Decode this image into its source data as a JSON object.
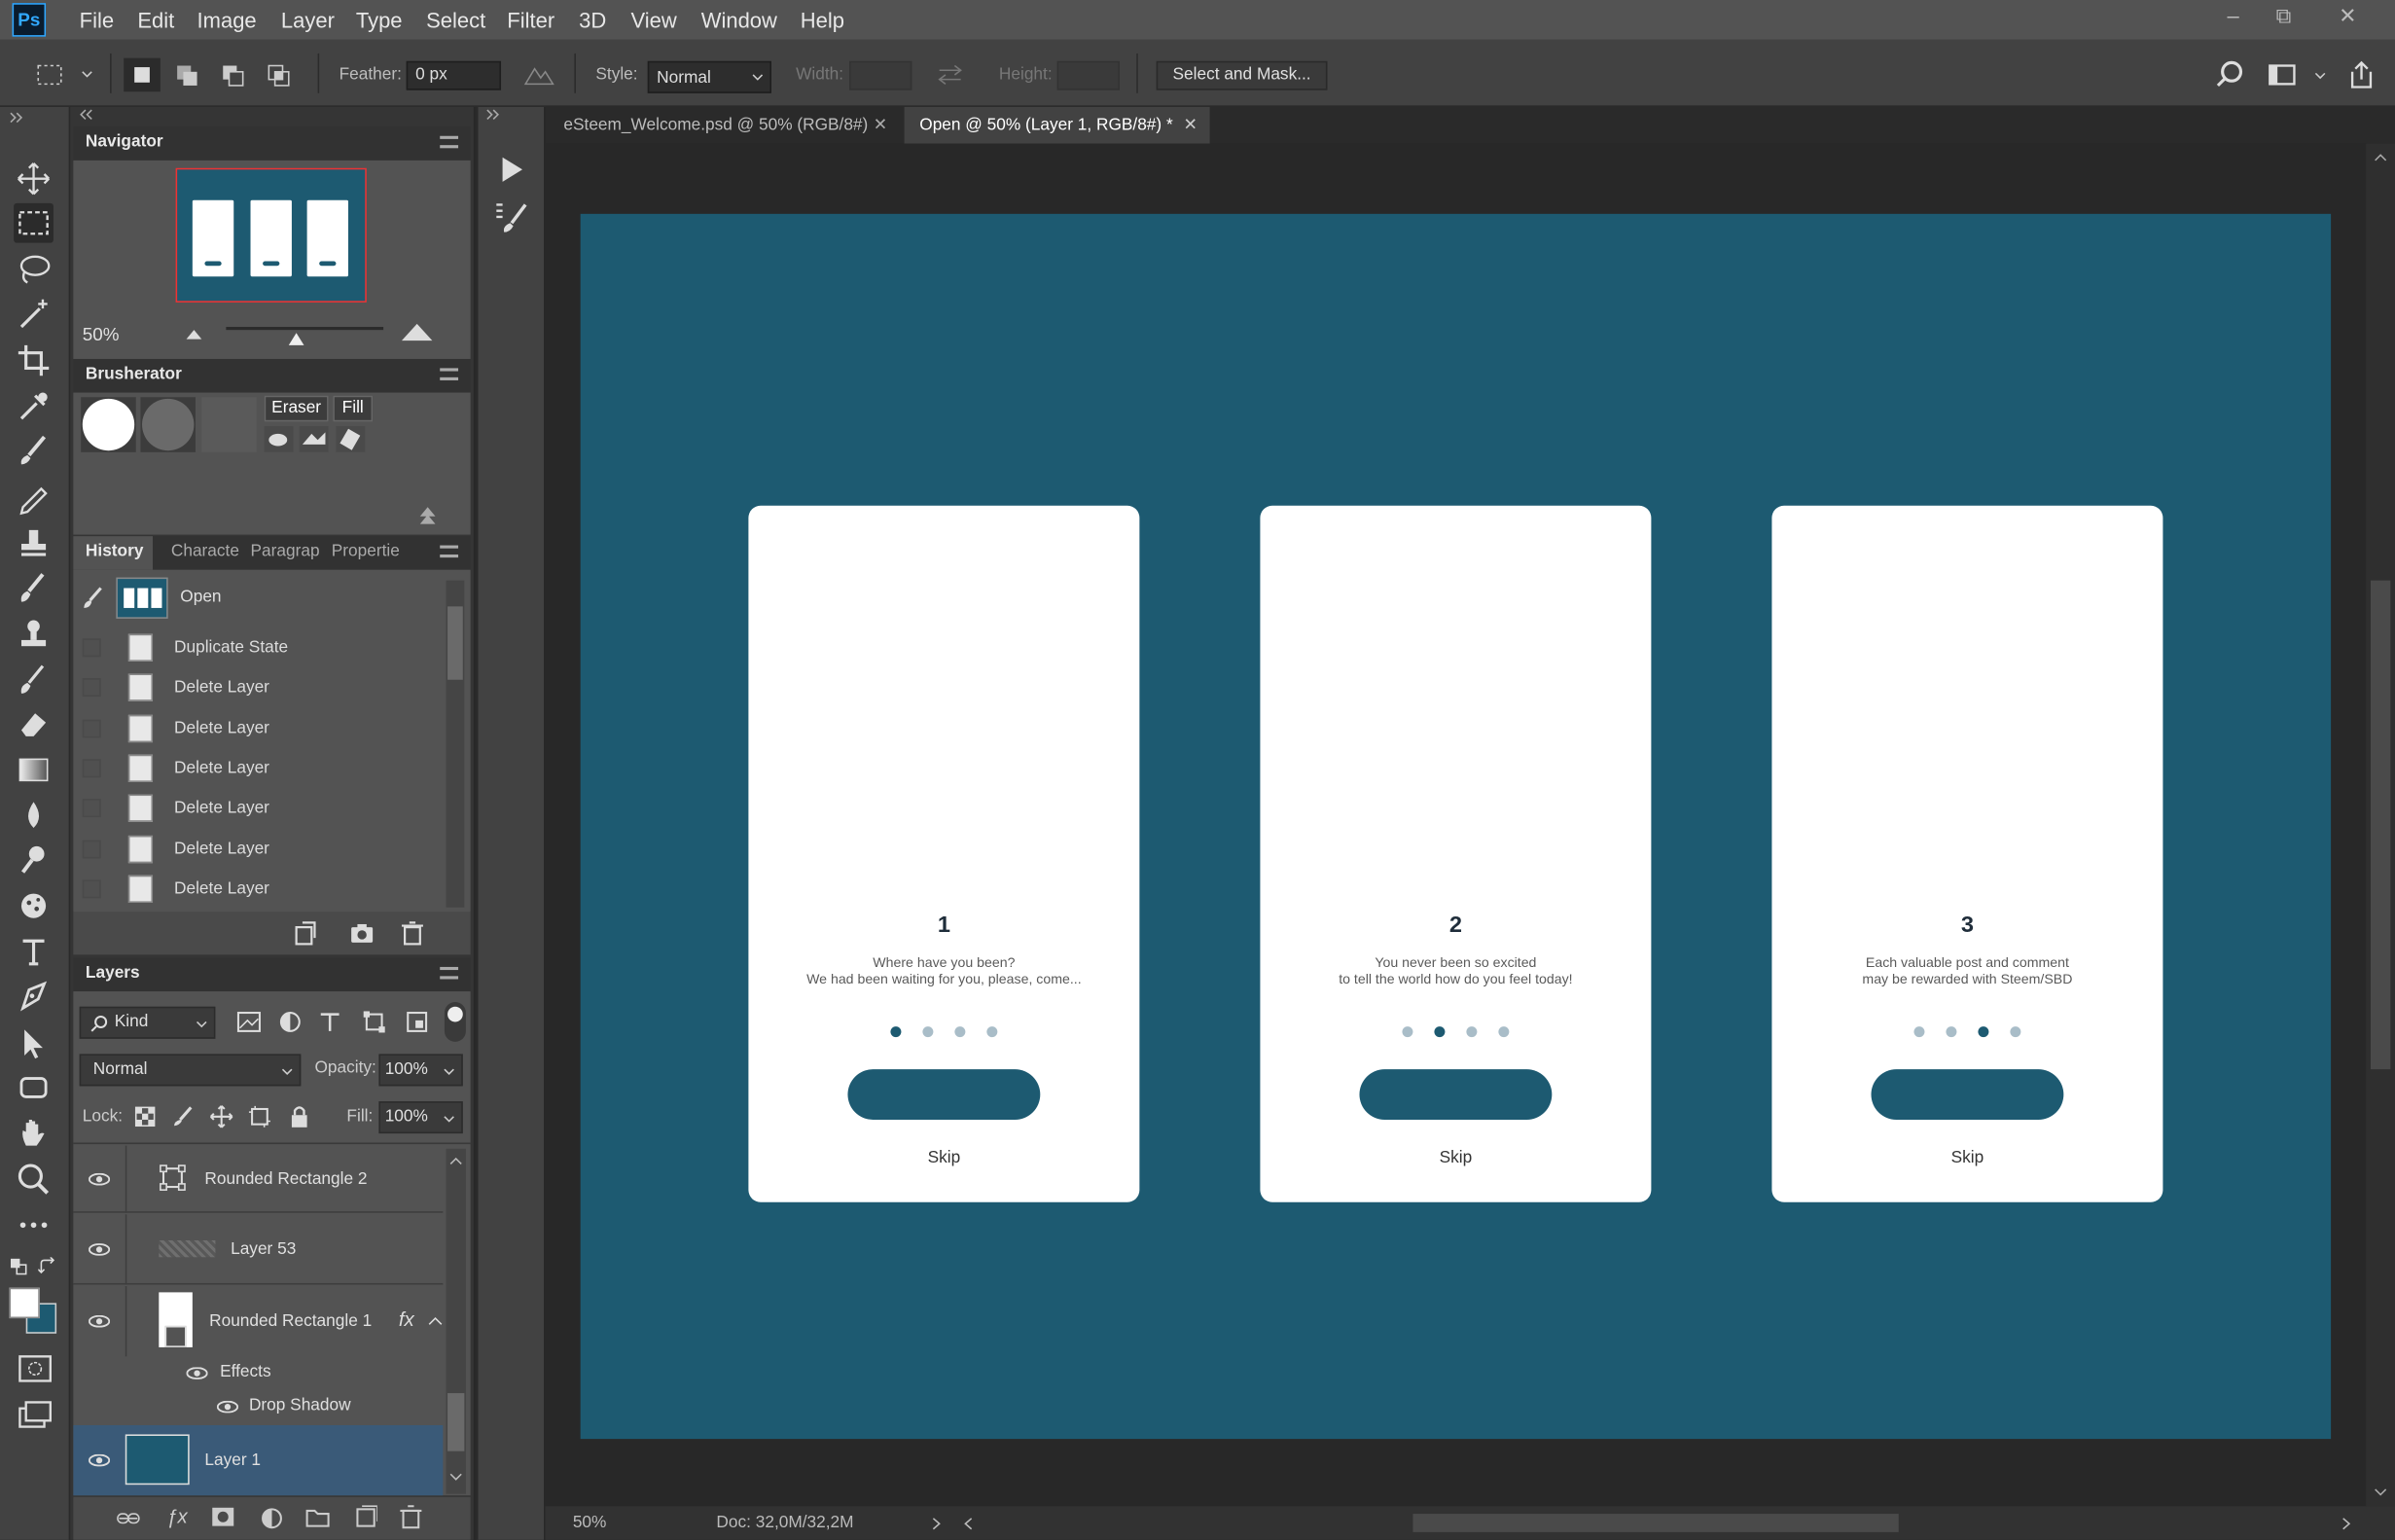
{
  "app": {
    "logo": "Ps"
  },
  "menu": [
    "File",
    "Edit",
    "Image",
    "Layer",
    "Type",
    "Select",
    "Filter",
    "3D",
    "View",
    "Window",
    "Help"
  ],
  "window_controls": {
    "minimize": "–",
    "restore": "⧉",
    "close": "✕"
  },
  "options": {
    "feather_label": "Feather:",
    "feather_value": "0 px",
    "style_label": "Style:",
    "style_value": "Normal",
    "width_label": "Width:",
    "height_label": "Height:",
    "select_mask": "Select and Mask..."
  },
  "navigator": {
    "title": "Navigator",
    "zoom": "50%"
  },
  "brusherator": {
    "title": "Brusherator",
    "eraser": "Eraser",
    "fill": "Fill"
  },
  "history": {
    "tabs": [
      "History",
      "Characte",
      "Paragrap",
      "Propertie"
    ],
    "snapshot": "Open",
    "items": [
      "Duplicate State",
      "Delete Layer",
      "Delete Layer",
      "Delete Layer",
      "Delete Layer",
      "Delete Layer",
      "Delete Layer"
    ]
  },
  "layers": {
    "title": "Layers",
    "filter_kind": "Kind",
    "blend_mode": "Normal",
    "opacity_label": "Opacity:",
    "opacity": "100%",
    "lock_label": "Lock:",
    "fill_label": "Fill:",
    "fill": "100%",
    "items": [
      {
        "name": "Rounded Rectangle 2"
      },
      {
        "name": "Layer 53"
      },
      {
        "name": "Rounded Rectangle 1",
        "fx": "fx",
        "effects_label": "Effects",
        "effect": "Drop Shadow"
      },
      {
        "name": "Layer 1",
        "selected": true
      }
    ]
  },
  "tabs": [
    {
      "title": "eSteem_Welcome.psd @ 50% (RGB/8#)",
      "active": false
    },
    {
      "title": "Open @ 50% (Layer 1, RGB/8#) *",
      "active": true
    }
  ],
  "cards": [
    {
      "number": "1",
      "line1": "Where have you been?",
      "line2": "We had been waiting for you, please, come...",
      "active_dot": 0,
      "skip": "Skip"
    },
    {
      "number": "2",
      "line1": "You never been so excited",
      "line2": "to tell the world how do you feel today!",
      "active_dot": 1,
      "skip": "Skip"
    },
    {
      "number": "3",
      "line1": "Each valuable post and comment",
      "line2": "may be rewarded with Steem/SBD",
      "active_dot": 2,
      "skip": "Skip"
    }
  ],
  "status": {
    "zoom": "50%",
    "doc": "Doc: 32,0M/32,2M"
  },
  "colors": {
    "artboard": "#1d5a71",
    "accent": "#31a8ff"
  }
}
